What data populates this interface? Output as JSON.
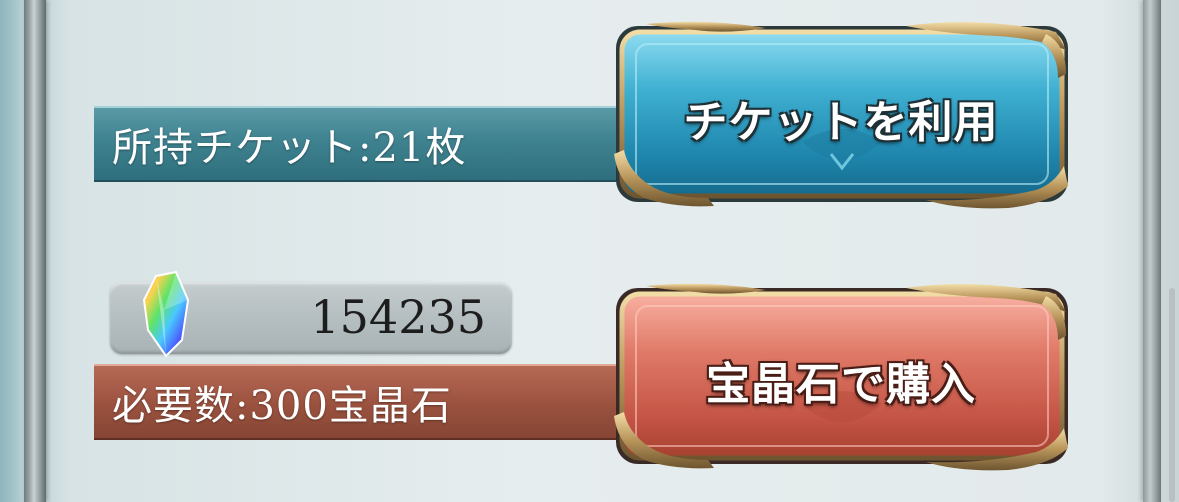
{
  "ticket": {
    "owned_label": "所持チケット:21枚",
    "button_label": "チケットを利用"
  },
  "crystal": {
    "balance": "154235",
    "icon": "rainbow-crystal-icon"
  },
  "purchase": {
    "required_label": "必要数:300宝晶石",
    "button_label": "宝晶石で購入"
  },
  "colors": {
    "ticket_bar": "#3f8290",
    "crystal_bar": "#9c5340",
    "ticket_button": "#3aa7c8",
    "crystal_button": "#d9665a",
    "ornament_gold": "#b8955a"
  }
}
